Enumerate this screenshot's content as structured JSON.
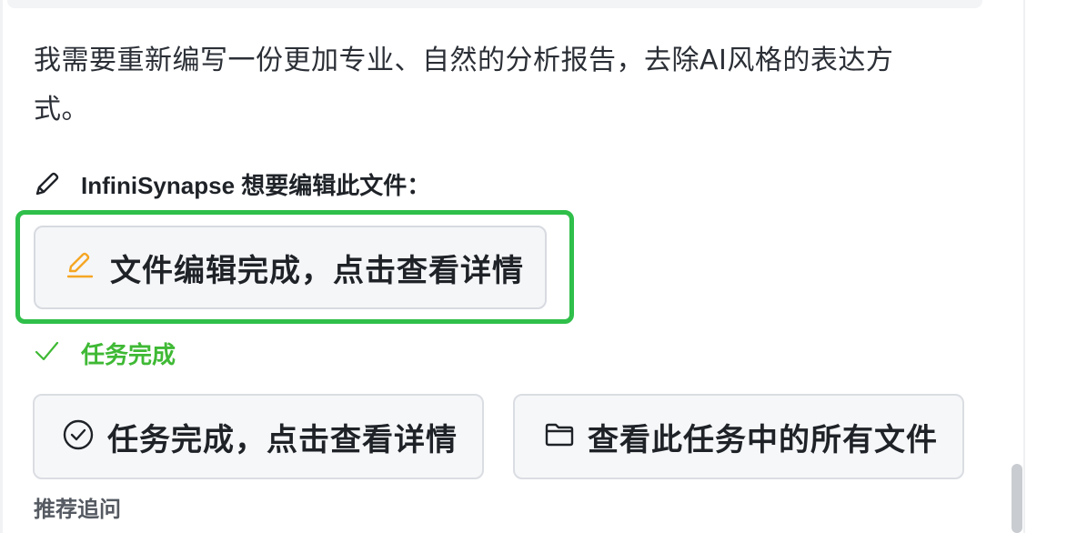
{
  "message": {
    "text": "我需要重新编写一份更加专业、自然的分析报告，去除AI风格的表达方式。"
  },
  "edit_notice": {
    "icon": "pencil-icon",
    "text": "InfiniSynapse 想要编辑此文件："
  },
  "file_edit_button": {
    "icon": "edit-icon",
    "label": "文件编辑完成，点击查看详情",
    "icon_color": "#f5a623"
  },
  "status": {
    "icon": "check-icon",
    "label": "任务完成",
    "color": "#3fb935"
  },
  "actions": [
    {
      "icon": "check-circle-icon",
      "label": "任务完成，点击查看详情"
    },
    {
      "icon": "folder-icon",
      "label": "查看此任务中的所有文件"
    }
  ],
  "suggestions": {
    "title": "推荐追问"
  },
  "colors": {
    "highlight": "#2fbf4a",
    "button_bg": "#f5f6f8",
    "button_border": "#d7dae0"
  }
}
